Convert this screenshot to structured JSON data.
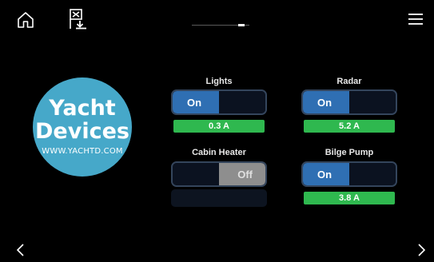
{
  "logo": {
    "line1": "Yacht",
    "line2": "Devices",
    "url": "WWW.YACHTD.COM",
    "color": "#46a8c9"
  },
  "switches": [
    {
      "label": "Lights",
      "on_label": "On",
      "state": "on",
      "current": "0.3 A"
    },
    {
      "label": "Radar",
      "on_label": "On",
      "state": "on",
      "current": "5.2 A"
    },
    {
      "label": "Cabin Heater",
      "off_label": "Off",
      "state": "off",
      "current": ""
    },
    {
      "label": "Bilge Pump",
      "on_label": "On",
      "state": "on",
      "current": "3.8 A"
    }
  ],
  "icons": {
    "home": "home-icon",
    "device": "device-icon",
    "menu": "hamburger-menu-icon",
    "prev": "chevron-left-icon",
    "next": "chevron-right-icon"
  },
  "colors": {
    "on": "#2f6fb3",
    "off": "#8e8e8e",
    "current_ok": "#2fb84f",
    "background": "#000000"
  }
}
